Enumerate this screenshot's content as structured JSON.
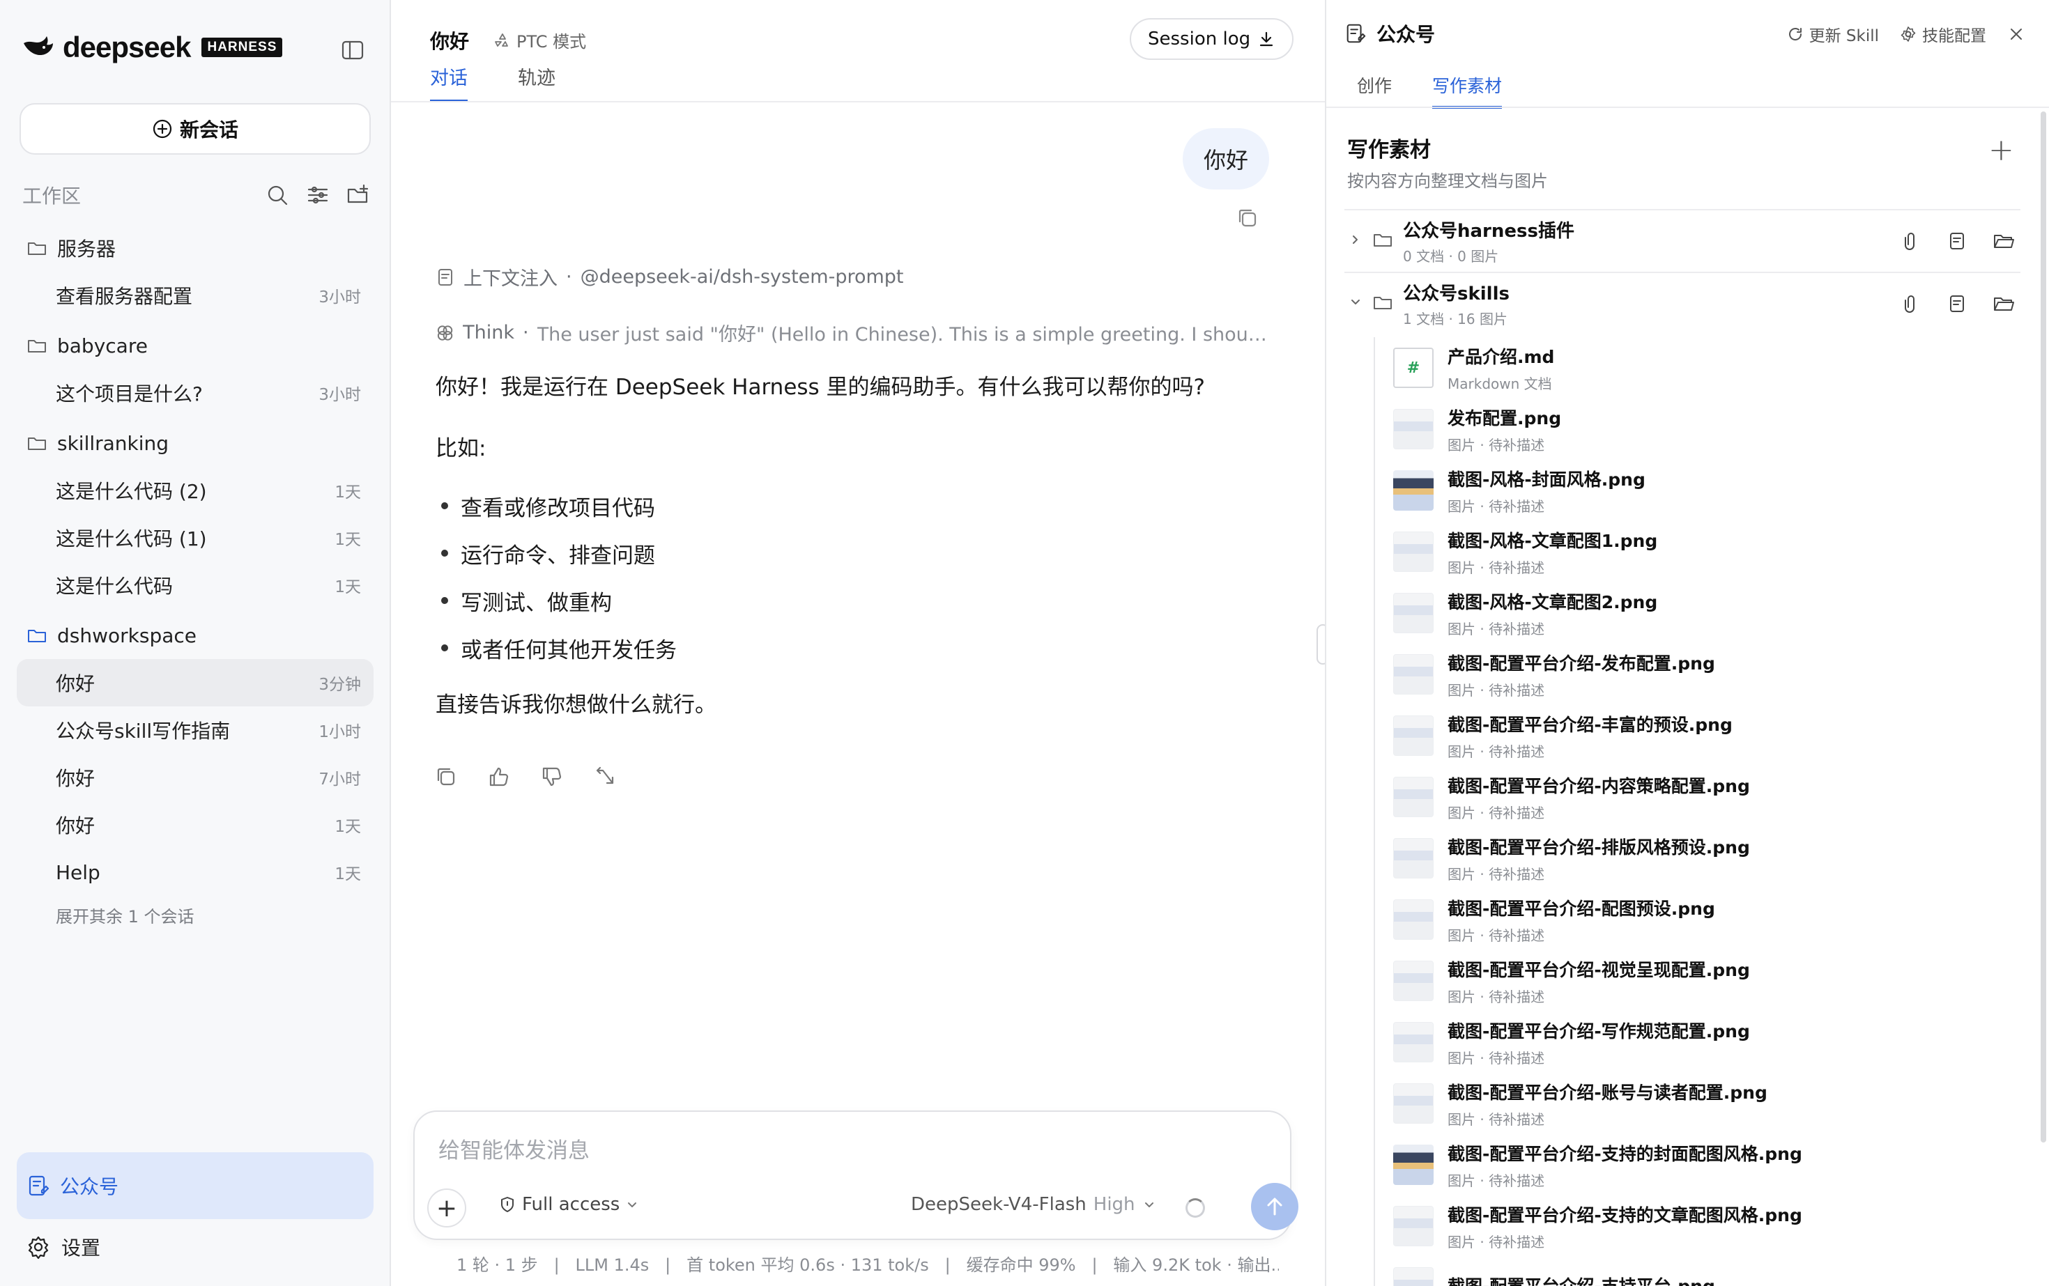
{
  "sidebar": {
    "brand": "deepseek",
    "brand_badge": "HARNESS",
    "new_chat_label": "新会话",
    "workspace_label": "工作区",
    "groups": [
      {
        "name": "服务器",
        "sessions": [
          {
            "title": "查看服务器配置",
            "time": "3小时"
          }
        ]
      },
      {
        "name": "babycare",
        "sessions": [
          {
            "title": "这个项目是什么?",
            "time": "3小时"
          }
        ]
      },
      {
        "name": "skillranking",
        "sessions": [
          {
            "title": "这是什么代码 (2)",
            "time": "1天"
          },
          {
            "title": "这是什么代码 (1)",
            "time": "1天"
          },
          {
            "title": "这是什么代码",
            "time": "1天"
          }
        ]
      },
      {
        "name": "dshworkspace",
        "sessions": [
          {
            "title": "你好",
            "time": "3分钟"
          },
          {
            "title": "公众号skill写作指南",
            "time": "1小时"
          },
          {
            "title": "你好",
            "time": "7小时"
          },
          {
            "title": "你好",
            "time": "1天"
          },
          {
            "title": "Help",
            "time": "1天"
          }
        ]
      }
    ],
    "expand_more": "展开其余 1 个会话",
    "active_app": "公众号",
    "settings_label": "设置"
  },
  "main": {
    "title": "你好",
    "mode": "PTC 模式",
    "session_log": "Session log",
    "tabs": [
      "对话",
      "轨迹"
    ],
    "user_message": "你好",
    "context_label": "上下文注入",
    "context_value": "@deepseek-ai/dsh-system-prompt",
    "think_label": "Think",
    "think_text": "The user just said \"你好\" (Hello in Chinese). This is a simple greeting. I should r...",
    "answer_intro": "你好！我是运行在 DeepSeek Harness 里的编码助手。有什么我可以帮你的吗?",
    "answer_example": "比如:",
    "answer_items": [
      "查看或修改项目代码",
      "运行命令、排查问题",
      "写测试、做重构",
      "或者任何其他开发任务"
    ],
    "answer_outro": "直接告诉我你想做什么就行。",
    "composer_placeholder": "给智能体发消息",
    "access_label": "Full access",
    "model_name": "DeepSeek-V4-Flash",
    "model_level": "High",
    "stats": "1 轮 · 1 步   |   LLM 1.4s   |   首 token 平均 0.6s · 131 tok/s   |   缓存命中 99%   |   输入 9.2K tok · 输出..."
  },
  "panel": {
    "title": "公众号",
    "refresh_label": "更新 Skill",
    "config_label": "技能配置",
    "tabs": [
      "创作",
      "写作素材"
    ],
    "section_title": "写作素材",
    "section_sub": "按内容方向整理文档与图片",
    "folders": [
      {
        "name": "公众号harness插件",
        "meta": "0 文档 · 0 图片"
      },
      {
        "name": "公众号skills",
        "meta": "1 文档 · 16 图片"
      }
    ],
    "files": [
      {
        "name": "产品介绍.md",
        "desc": "Markdown 文档"
      },
      {
        "name": "发布配置.png",
        "desc": "图片 · 待补描述"
      },
      {
        "name": "截图-风格-封面风格.png",
        "desc": "图片 · 待补描述"
      },
      {
        "name": "截图-风格-文章配图1.png",
        "desc": "图片 · 待补描述"
      },
      {
        "name": "截图-风格-文章配图2.png",
        "desc": "图片 · 待补描述"
      },
      {
        "name": "截图-配置平台介绍-发布配置.png",
        "desc": "图片 · 待补描述"
      },
      {
        "name": "截图-配置平台介绍-丰富的预设.png",
        "desc": "图片 · 待补描述"
      },
      {
        "name": "截图-配置平台介绍-内容策略配置.png",
        "desc": "图片 · 待补描述"
      },
      {
        "name": "截图-配置平台介绍-排版风格预设.png",
        "desc": "图片 · 待补描述"
      },
      {
        "name": "截图-配置平台介绍-配图预设.png",
        "desc": "图片 · 待补描述"
      },
      {
        "name": "截图-配置平台介绍-视觉呈现配置.png",
        "desc": "图片 · 待补描述"
      },
      {
        "name": "截图-配置平台介绍-写作规范配置.png",
        "desc": "图片 · 待补描述"
      },
      {
        "name": "截图-配置平台介绍-账号与读者配置.png",
        "desc": "图片 · 待补描述"
      },
      {
        "name": "截图-配置平台介绍-支持的封面配图风格.png",
        "desc": "图片 · 待补描述"
      },
      {
        "name": "截图-配置平台介绍-支持的文章配图风格.png",
        "desc": "图片 · 待补描述"
      },
      {
        "name": "截图-配置平台介绍-支持平台.png",
        "desc": ""
      }
    ]
  },
  "colors": {
    "accent": "#2a62d8",
    "active_nav_bg": "#dfe8fb",
    "send_button": "#a9c1ef"
  }
}
